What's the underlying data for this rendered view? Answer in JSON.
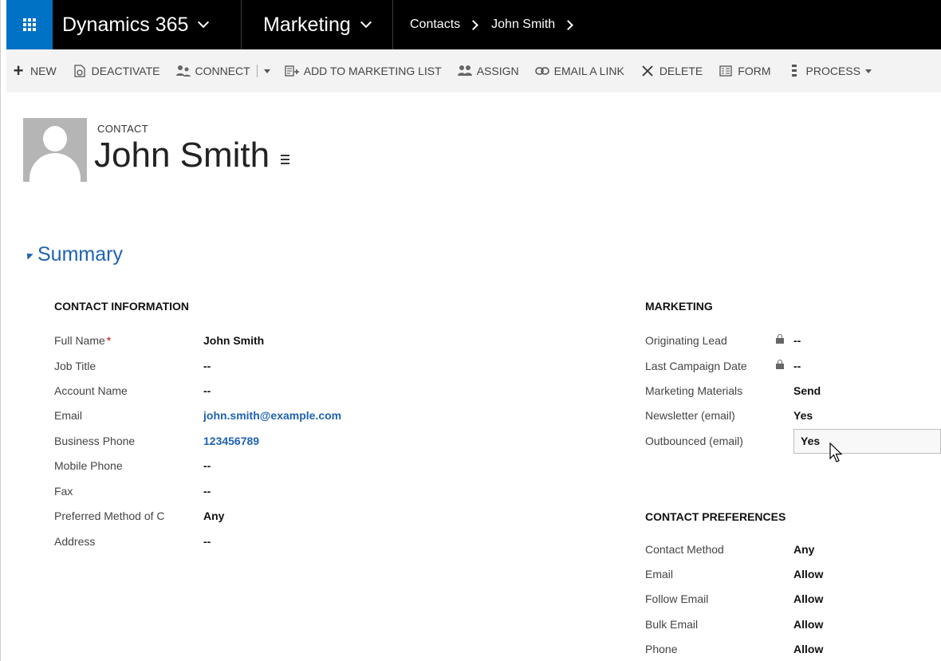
{
  "topnav": {
    "app_name": "Dynamics 365",
    "module": "Marketing",
    "breadcrumb": [
      "Contacts",
      "John Smith"
    ]
  },
  "commands": [
    {
      "label": "NEW",
      "icon": "plus-icon"
    },
    {
      "label": "DEACTIVATE",
      "icon": "deactivate-icon"
    },
    {
      "label": "CONNECT",
      "icon": "connect-icon"
    },
    {
      "label": "ADD TO MARKETING LIST",
      "icon": "add-to-list-icon"
    },
    {
      "label": "ASSIGN",
      "icon": "assign-icon"
    },
    {
      "label": "EMAIL A LINK",
      "icon": "link-icon"
    },
    {
      "label": "DELETE",
      "icon": "delete-icon"
    },
    {
      "label": "FORM",
      "icon": "form-icon"
    },
    {
      "label": "PROCESS",
      "icon": "process-icon"
    }
  ],
  "header": {
    "entity": "CONTACT",
    "name": "John Smith"
  },
  "summary": {
    "title": "Summary",
    "contact_info": {
      "title": "CONTACT INFORMATION",
      "rows": [
        {
          "label": "Full Name",
          "value": "John Smith"
        },
        {
          "label": "Job Title",
          "value": "--"
        },
        {
          "label": "Account Name",
          "value": "--"
        },
        {
          "label": "Email",
          "value": "john.smith@example.com"
        },
        {
          "label": "Business Phone",
          "value": "123456789"
        },
        {
          "label": "Mobile Phone",
          "value": "--"
        },
        {
          "label": "Fax",
          "value": "--"
        },
        {
          "label": "Preferred Method of C",
          "value": "Any"
        },
        {
          "label": "Address",
          "value": "--"
        }
      ]
    },
    "marketing": {
      "title": "MARKETING",
      "rows": [
        {
          "label": "Originating Lead",
          "value": "--"
        },
        {
          "label": "Last Campaign Date",
          "value": "--"
        },
        {
          "label": "Marketing Materials",
          "value": "Send"
        },
        {
          "label": "Newsletter (email)",
          "value": "Yes"
        },
        {
          "label": "Outbounced (email)",
          "value": "Yes"
        }
      ]
    },
    "preferences": {
      "title": "CONTACT PREFERENCES",
      "rows": [
        {
          "label": "Contact Method",
          "value": "Any"
        },
        {
          "label": "Email",
          "value": "Allow"
        },
        {
          "label": "Follow Email",
          "value": "Allow"
        },
        {
          "label": "Bulk Email",
          "value": "Allow"
        },
        {
          "label": "Phone",
          "value": "Allow"
        }
      ]
    }
  },
  "colors": {
    "accent": "#0072c6",
    "link": "#1e62b3",
    "required": "#dd0000"
  }
}
